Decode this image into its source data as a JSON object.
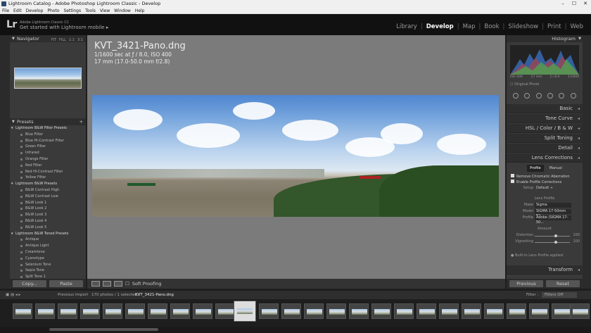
{
  "window": {
    "title": "Lightroom Catalog - Adobe Photoshop Lightroom Classic - Develop",
    "controls": [
      "–",
      "☐",
      "✕"
    ]
  },
  "menu": [
    "File",
    "Edit",
    "Develop",
    "Photo",
    "Settings",
    "Tools",
    "View",
    "Window",
    "Help"
  ],
  "identity": {
    "logo": "Lr",
    "sub1": "Adobe Lightroom Classic CC",
    "sub2": "Get started with Lightroom mobile ▸"
  },
  "modules": [
    {
      "label": "Library",
      "active": false
    },
    {
      "label": "Develop",
      "active": true
    },
    {
      "label": "Map",
      "active": false
    },
    {
      "label": "Book",
      "active": false
    },
    {
      "label": "Slideshow",
      "active": false
    },
    {
      "label": "Print",
      "active": false
    },
    {
      "label": "Web",
      "active": false
    }
  ],
  "navigator": {
    "title": "Navigator",
    "zoom": [
      "FIT",
      "FILL",
      "1:1",
      "3:1"
    ]
  },
  "presets": {
    "title": "Presets",
    "groups": [
      {
        "name": "Lightroom B&W Filter Presets",
        "items": [
          "Blue Filter",
          "Blue Hi-Contrast Filter",
          "Green Filter",
          "Infrared",
          "Orange Filter",
          "Red Filter",
          "Red Hi-Contrast Filter",
          "Yellow Filter"
        ]
      },
      {
        "name": "Lightroom B&W Presets",
        "items": [
          "B&W Contrast High",
          "B&W Contrast Low",
          "B&W Look 1",
          "B&W Look 2",
          "B&W Look 3",
          "B&W Look 4",
          "B&W Look 5"
        ]
      },
      {
        "name": "Lightroom B&W Toned Presets",
        "items": [
          "Antique",
          "Antique Light",
          "Creamtone",
          "Cyanotype",
          "Selenium Tone",
          "Sepia Tone",
          "Split Tone 1"
        ]
      }
    ]
  },
  "left_buttons": {
    "copy": "Copy...",
    "paste": "Paste"
  },
  "photo": {
    "filename": "KVT_3421-Pano.dng",
    "exif1": "1/1600 sec at ƒ / 8.0, ISO 400",
    "exif2": "17 mm (17.0-50.0 mm f/2.8)"
  },
  "toolbar": {
    "soft_proofing": "Soft Proofing"
  },
  "histogram": {
    "title": "Histogram",
    "info": [
      "ISO 400",
      "17 mm",
      "ƒ / 8.0",
      "1/1600"
    ],
    "original_photo": "Original Photo"
  },
  "right_sections": [
    "Basic",
    "Tone Curve",
    "HSL  /  Color  /  B & W",
    "Split Toning",
    "Detail",
    "Lens Corrections",
    "Transform"
  ],
  "lens": {
    "tabs": [
      "Profile",
      "Manual"
    ],
    "remove_ca": "Remove Chromatic Aberration",
    "enable_profile": "Enable Profile Corrections",
    "setup_label": "Setup",
    "setup_value": "Default ÷",
    "lens_profile": "Lens Profile",
    "make_label": "Make",
    "make_value": "Sigma",
    "model_label": "Model",
    "model_value": "SIGMA 17-50mm F2...",
    "profile_label": "Profile",
    "profile_value": "Adobe (SIGMA 17-50...",
    "amount": "Amount",
    "distortion_label": "Distortion",
    "distortion_value": "100",
    "vignetting_label": "Vignetting",
    "vignetting_value": "100",
    "builtin": "Built-in Lens Profile applied."
  },
  "right_buttons": {
    "previous": "Previous",
    "reset": "Reset"
  },
  "filmstrip_bar": {
    "source": "Previous Import",
    "info": "170 photos / 1 selected /",
    "file": "KVT_3421-Pano.dng",
    "filter_label": "Filter :",
    "filter_value": "Filters Off"
  }
}
